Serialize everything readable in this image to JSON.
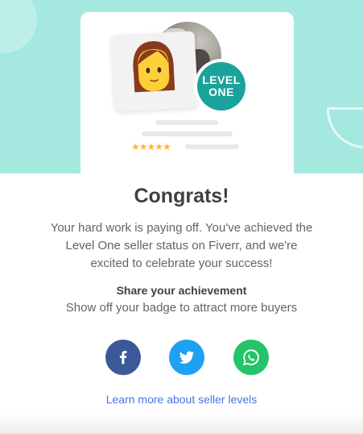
{
  "hero": {
    "badge_line1": "LEVEL",
    "badge_line2": "ONE",
    "stars": "★★★★★"
  },
  "content": {
    "title": "Congrats!",
    "body": "Your hard work is paying off. You've achieved the Level One seller status on Fiverr, and we're excited to celebrate your success!",
    "share_title": "Share your achievement",
    "share_subtitle": "Show off your badge to attract more buyers"
  },
  "share_buttons": [
    {
      "name": "facebook",
      "icon": "facebook-icon",
      "color": "#3b5998"
    },
    {
      "name": "twitter",
      "icon": "twitter-icon",
      "color": "#1da1f2"
    },
    {
      "name": "whatsapp",
      "icon": "whatsapp-icon",
      "color": "#25c46a"
    }
  ],
  "footer": {
    "learn_more": "Learn more about seller levels"
  },
  "colors": {
    "hero_bg": "#a4e8df",
    "badge": "#1aa39a",
    "link": "#4a73e8",
    "stars": "#ffb33e"
  }
}
